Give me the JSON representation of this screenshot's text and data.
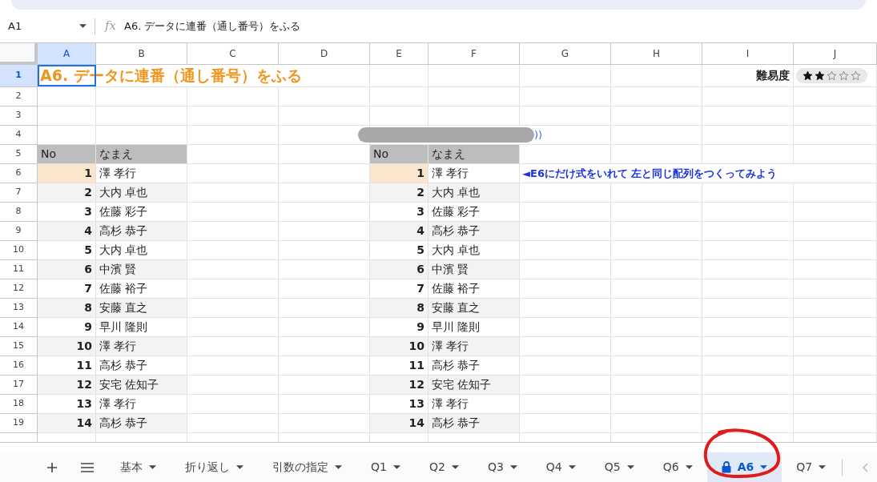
{
  "name_box": "A1",
  "formula_icon": "fx",
  "formula": "A6. データに連番（通し番号）をふる",
  "columns": [
    {
      "label": "A",
      "selected": true
    },
    {
      "label": "B",
      "selected": false
    },
    {
      "label": "C",
      "selected": false
    },
    {
      "label": "D",
      "selected": false
    },
    {
      "label": "E",
      "selected": false
    },
    {
      "label": "F",
      "selected": false
    },
    {
      "label": "G",
      "selected": false
    },
    {
      "label": "H",
      "selected": false
    },
    {
      "label": "I",
      "selected": false
    },
    {
      "label": "J",
      "selected": false
    }
  ],
  "row_numbers": [
    {
      "label": "1",
      "selected": true
    },
    {
      "label": "2",
      "selected": false
    },
    {
      "label": "3",
      "selected": false
    },
    {
      "label": "4",
      "selected": false
    },
    {
      "label": "5",
      "selected": false
    },
    {
      "label": "6",
      "selected": false
    },
    {
      "label": "7",
      "selected": false
    },
    {
      "label": "8",
      "selected": false
    },
    {
      "label": "9",
      "selected": false
    },
    {
      "label": "10",
      "selected": false
    },
    {
      "label": "11",
      "selected": false
    },
    {
      "label": "12",
      "selected": false
    },
    {
      "label": "13",
      "selected": false
    },
    {
      "label": "14",
      "selected": false
    },
    {
      "label": "15",
      "selected": false
    },
    {
      "label": "16",
      "selected": false
    },
    {
      "label": "17",
      "selected": false
    },
    {
      "label": "18",
      "selected": false
    },
    {
      "label": "19",
      "selected": false
    }
  ],
  "title": "A6. データに連番（通し番号）をふる",
  "difficulty": {
    "label": "難易度",
    "stars": 2
  },
  "row4_text": "))",
  "left_headers": [
    "No",
    "なまえ"
  ],
  "right_headers": [
    "No",
    "なまえ"
  ],
  "left_table": [
    {
      "no": "1",
      "name": "澤 孝行",
      "highlight": true
    },
    {
      "no": "2",
      "name": "大内 卓也",
      "highlight": false
    },
    {
      "no": "3",
      "name": "佐藤 彩子",
      "highlight": false
    },
    {
      "no": "4",
      "name": "高杉 恭子",
      "highlight": false
    },
    {
      "no": "5",
      "name": "大内 卓也",
      "highlight": false
    },
    {
      "no": "6",
      "name": "中濱 賢",
      "highlight": false
    },
    {
      "no": "7",
      "name": "佐藤 裕子",
      "highlight": false
    },
    {
      "no": "8",
      "name": "安藤 直之",
      "highlight": false
    },
    {
      "no": "9",
      "name": "早川 隆則",
      "highlight": false
    },
    {
      "no": "10",
      "name": "澤 孝行",
      "highlight": false
    },
    {
      "no": "11",
      "name": "高杉 恭子",
      "highlight": false
    },
    {
      "no": "12",
      "name": "安宅 佐知子",
      "highlight": false
    },
    {
      "no": "13",
      "name": "澤 孝行",
      "highlight": false
    },
    {
      "no": "14",
      "name": "高杉 恭子",
      "highlight": false
    }
  ],
  "right_table": [
    {
      "no": "1",
      "name": "澤 孝行",
      "highlight": true
    },
    {
      "no": "2",
      "name": "大内 卓也",
      "highlight": false
    },
    {
      "no": "3",
      "name": "佐藤 彩子",
      "highlight": false
    },
    {
      "no": "4",
      "name": "高杉 恭子",
      "highlight": false
    },
    {
      "no": "5",
      "name": "大内 卓也",
      "highlight": false
    },
    {
      "no": "6",
      "name": "中濱 賢",
      "highlight": false
    },
    {
      "no": "7",
      "name": "佐藤 裕子",
      "highlight": false
    },
    {
      "no": "8",
      "name": "安藤 直之",
      "highlight": false
    },
    {
      "no": "9",
      "name": "早川 隆則",
      "highlight": false
    },
    {
      "no": "10",
      "name": "澤 孝行",
      "highlight": false
    },
    {
      "no": "11",
      "name": "高杉 恭子",
      "highlight": false
    },
    {
      "no": "12",
      "name": "安宅 佐知子",
      "highlight": false
    },
    {
      "no": "13",
      "name": "澤 孝行",
      "highlight": false
    },
    {
      "no": "14",
      "name": "高杉 恭子",
      "highlight": false
    }
  ],
  "instruction": "◄E6にだけ式をいれて 左と同じ配列をつくってみよう",
  "sheet_tabs": [
    {
      "label": "基本",
      "selected": false,
      "locked": false
    },
    {
      "label": "折り返し",
      "selected": false,
      "locked": false
    },
    {
      "label": "引数の指定",
      "selected": false,
      "locked": false
    },
    {
      "label": "Q1",
      "selected": false,
      "locked": false
    },
    {
      "label": "Q2",
      "selected": false,
      "locked": false
    },
    {
      "label": "Q3",
      "selected": false,
      "locked": false
    },
    {
      "label": "Q4",
      "selected": false,
      "locked": false
    },
    {
      "label": "Q5",
      "selected": false,
      "locked": false
    },
    {
      "label": "Q6",
      "selected": false,
      "locked": false
    },
    {
      "label": "A6",
      "selected": true,
      "locked": true
    },
    {
      "label": "Q7",
      "selected": false,
      "locked": false
    }
  ]
}
